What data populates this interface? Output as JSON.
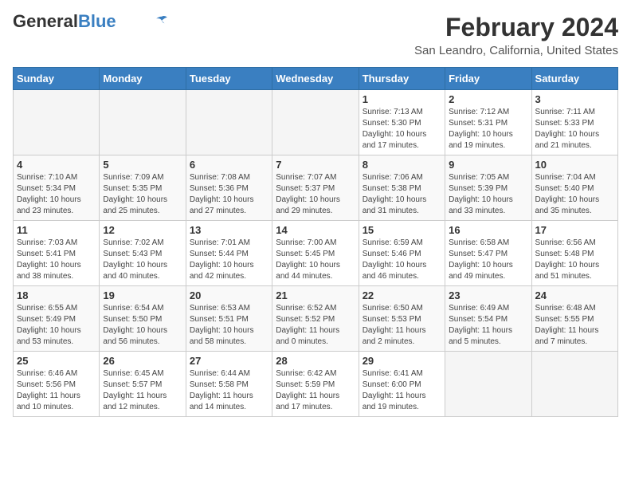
{
  "header": {
    "logo_line1": "General",
    "logo_line2": "Blue",
    "month_year": "February 2024",
    "location": "San Leandro, California, United States"
  },
  "weekdays": [
    "Sunday",
    "Monday",
    "Tuesday",
    "Wednesday",
    "Thursday",
    "Friday",
    "Saturday"
  ],
  "weeks": [
    [
      {
        "day": "",
        "info": ""
      },
      {
        "day": "",
        "info": ""
      },
      {
        "day": "",
        "info": ""
      },
      {
        "day": "",
        "info": ""
      },
      {
        "day": "1",
        "info": "Sunrise: 7:13 AM\nSunset: 5:30 PM\nDaylight: 10 hours\nand 17 minutes."
      },
      {
        "day": "2",
        "info": "Sunrise: 7:12 AM\nSunset: 5:31 PM\nDaylight: 10 hours\nand 19 minutes."
      },
      {
        "day": "3",
        "info": "Sunrise: 7:11 AM\nSunset: 5:33 PM\nDaylight: 10 hours\nand 21 minutes."
      }
    ],
    [
      {
        "day": "4",
        "info": "Sunrise: 7:10 AM\nSunset: 5:34 PM\nDaylight: 10 hours\nand 23 minutes."
      },
      {
        "day": "5",
        "info": "Sunrise: 7:09 AM\nSunset: 5:35 PM\nDaylight: 10 hours\nand 25 minutes."
      },
      {
        "day": "6",
        "info": "Sunrise: 7:08 AM\nSunset: 5:36 PM\nDaylight: 10 hours\nand 27 minutes."
      },
      {
        "day": "7",
        "info": "Sunrise: 7:07 AM\nSunset: 5:37 PM\nDaylight: 10 hours\nand 29 minutes."
      },
      {
        "day": "8",
        "info": "Sunrise: 7:06 AM\nSunset: 5:38 PM\nDaylight: 10 hours\nand 31 minutes."
      },
      {
        "day": "9",
        "info": "Sunrise: 7:05 AM\nSunset: 5:39 PM\nDaylight: 10 hours\nand 33 minutes."
      },
      {
        "day": "10",
        "info": "Sunrise: 7:04 AM\nSunset: 5:40 PM\nDaylight: 10 hours\nand 35 minutes."
      }
    ],
    [
      {
        "day": "11",
        "info": "Sunrise: 7:03 AM\nSunset: 5:41 PM\nDaylight: 10 hours\nand 38 minutes."
      },
      {
        "day": "12",
        "info": "Sunrise: 7:02 AM\nSunset: 5:43 PM\nDaylight: 10 hours\nand 40 minutes."
      },
      {
        "day": "13",
        "info": "Sunrise: 7:01 AM\nSunset: 5:44 PM\nDaylight: 10 hours\nand 42 minutes."
      },
      {
        "day": "14",
        "info": "Sunrise: 7:00 AM\nSunset: 5:45 PM\nDaylight: 10 hours\nand 44 minutes."
      },
      {
        "day": "15",
        "info": "Sunrise: 6:59 AM\nSunset: 5:46 PM\nDaylight: 10 hours\nand 46 minutes."
      },
      {
        "day": "16",
        "info": "Sunrise: 6:58 AM\nSunset: 5:47 PM\nDaylight: 10 hours\nand 49 minutes."
      },
      {
        "day": "17",
        "info": "Sunrise: 6:56 AM\nSunset: 5:48 PM\nDaylight: 10 hours\nand 51 minutes."
      }
    ],
    [
      {
        "day": "18",
        "info": "Sunrise: 6:55 AM\nSunset: 5:49 PM\nDaylight: 10 hours\nand 53 minutes."
      },
      {
        "day": "19",
        "info": "Sunrise: 6:54 AM\nSunset: 5:50 PM\nDaylight: 10 hours\nand 56 minutes."
      },
      {
        "day": "20",
        "info": "Sunrise: 6:53 AM\nSunset: 5:51 PM\nDaylight: 10 hours\nand 58 minutes."
      },
      {
        "day": "21",
        "info": "Sunrise: 6:52 AM\nSunset: 5:52 PM\nDaylight: 11 hours\nand 0 minutes."
      },
      {
        "day": "22",
        "info": "Sunrise: 6:50 AM\nSunset: 5:53 PM\nDaylight: 11 hours\nand 2 minutes."
      },
      {
        "day": "23",
        "info": "Sunrise: 6:49 AM\nSunset: 5:54 PM\nDaylight: 11 hours\nand 5 minutes."
      },
      {
        "day": "24",
        "info": "Sunrise: 6:48 AM\nSunset: 5:55 PM\nDaylight: 11 hours\nand 7 minutes."
      }
    ],
    [
      {
        "day": "25",
        "info": "Sunrise: 6:46 AM\nSunset: 5:56 PM\nDaylight: 11 hours\nand 10 minutes."
      },
      {
        "day": "26",
        "info": "Sunrise: 6:45 AM\nSunset: 5:57 PM\nDaylight: 11 hours\nand 12 minutes."
      },
      {
        "day": "27",
        "info": "Sunrise: 6:44 AM\nSunset: 5:58 PM\nDaylight: 11 hours\nand 14 minutes."
      },
      {
        "day": "28",
        "info": "Sunrise: 6:42 AM\nSunset: 5:59 PM\nDaylight: 11 hours\nand 17 minutes."
      },
      {
        "day": "29",
        "info": "Sunrise: 6:41 AM\nSunset: 6:00 PM\nDaylight: 11 hours\nand 19 minutes."
      },
      {
        "day": "",
        "info": ""
      },
      {
        "day": "",
        "info": ""
      }
    ]
  ]
}
